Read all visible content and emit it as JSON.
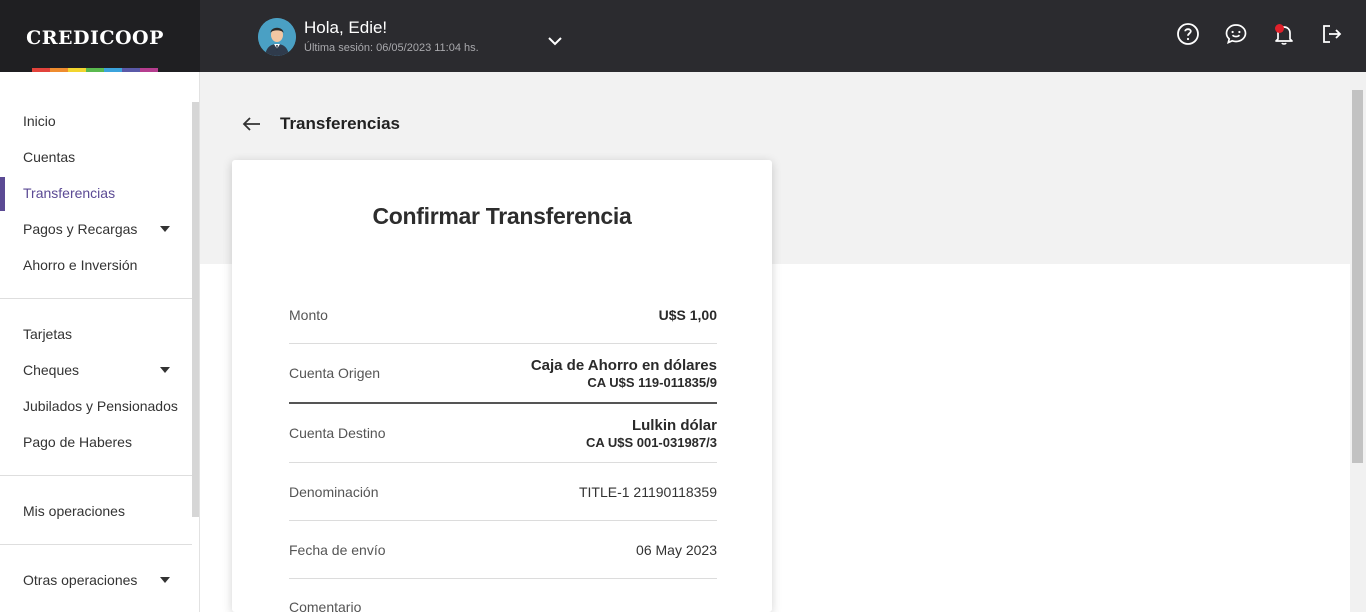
{
  "brand": {
    "name": "CREDICOOP",
    "stripe_colors": [
      "#e2433b",
      "#ef8c2f",
      "#f2d52e",
      "#5ab94f",
      "#3ba3dc",
      "#5a59a8",
      "#b53d8f"
    ]
  },
  "header": {
    "greeting": "Hola, Edie!",
    "last_session": "Última sesión: 06/05/2023 11:04 hs.",
    "icons": [
      "help-icon",
      "chat-icon",
      "bell-icon",
      "logout-icon"
    ]
  },
  "sidebar": {
    "groups": [
      [
        {
          "label": "Inicio"
        },
        {
          "label": "Cuentas"
        },
        {
          "label": "Transferencias",
          "active": true
        },
        {
          "label": "Pagos y Recargas",
          "expandable": true
        },
        {
          "label": "Ahorro e Inversión"
        }
      ],
      [
        {
          "label": "Tarjetas"
        },
        {
          "label": "Cheques",
          "expandable": true
        },
        {
          "label": "Jubilados y Pensionados"
        },
        {
          "label": "Pago de Haberes"
        }
      ],
      [
        {
          "label": "Mis operaciones"
        }
      ],
      [
        {
          "label": "Otras operaciones",
          "expandable": true
        }
      ]
    ]
  },
  "main": {
    "title": "Transferencias",
    "card": {
      "title": "Confirmar Transferencia",
      "rows": {
        "monto": {
          "label": "Monto",
          "value": "U$S 1,00"
        },
        "origen": {
          "label": "Cuenta Origen",
          "value": "Caja de Ahorro en dólares",
          "sub": "CA U$S 119-011835/9"
        },
        "destino": {
          "label": "Cuenta Destino",
          "value": "Lulkin dólar",
          "sub": "CA U$S 001-031987/3"
        },
        "denominacion": {
          "label": "Denominación",
          "value": "TITLE-1 21190118359"
        },
        "fecha": {
          "label": "Fecha de envío",
          "value": "06 May 2023"
        },
        "comentario": {
          "label": "Comentario",
          "value": ""
        }
      }
    }
  }
}
